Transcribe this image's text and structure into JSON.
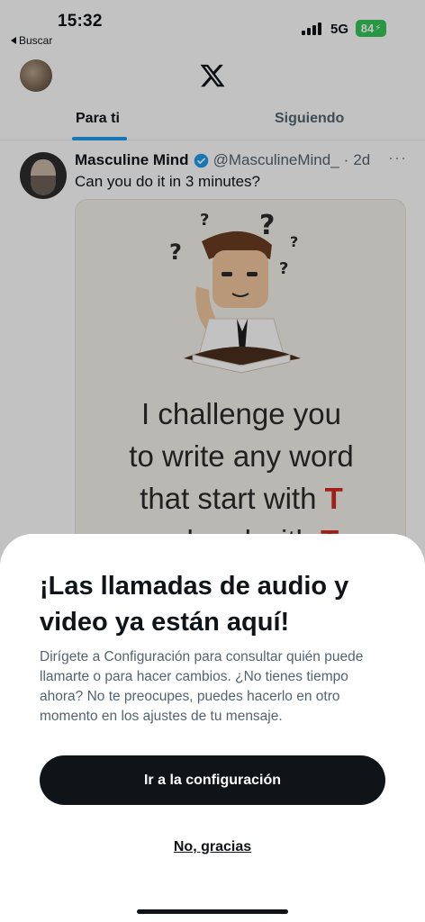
{
  "status_bar": {
    "time": "15:32",
    "back_app_label": "Buscar",
    "network": "5G",
    "battery": "84"
  },
  "top_bar": {
    "logo_icon": "x-logo-icon"
  },
  "tabs": [
    {
      "label": "Para ti",
      "active": true
    },
    {
      "label": "Siguiendo",
      "active": false
    }
  ],
  "tweet": {
    "author_name": "Masculine Mind",
    "handle": "@MasculineMind_",
    "separator": "·",
    "time": "2d",
    "more": "···",
    "text": "Can you do it in 3 minutes?",
    "image_lines": {
      "line1": "I challenge you",
      "line2": "to write any word",
      "line3_prefix": "that start with ",
      "line3_letter": "T",
      "line4_prefix": "and end with ",
      "line4_letter": "T"
    }
  },
  "sheet": {
    "title": "¡Las llamadas de audio y video ya están aquí!",
    "body": "Dirígete a Configuración para consultar quién puede llamarte o para hacer cambios. ¿No tienes tiempo ahora? No te preocupes, puedes hacerlo en otro momento en los ajustes de tu mensaje.",
    "primary_button": "Ir a la configuración",
    "secondary_button": "No, gracias"
  },
  "colors": {
    "accent": "#1d9bf0",
    "text_primary": "#0f1419",
    "text_secondary": "#536471",
    "battery": "#34c759",
    "highlight_red": "#d42a20"
  }
}
